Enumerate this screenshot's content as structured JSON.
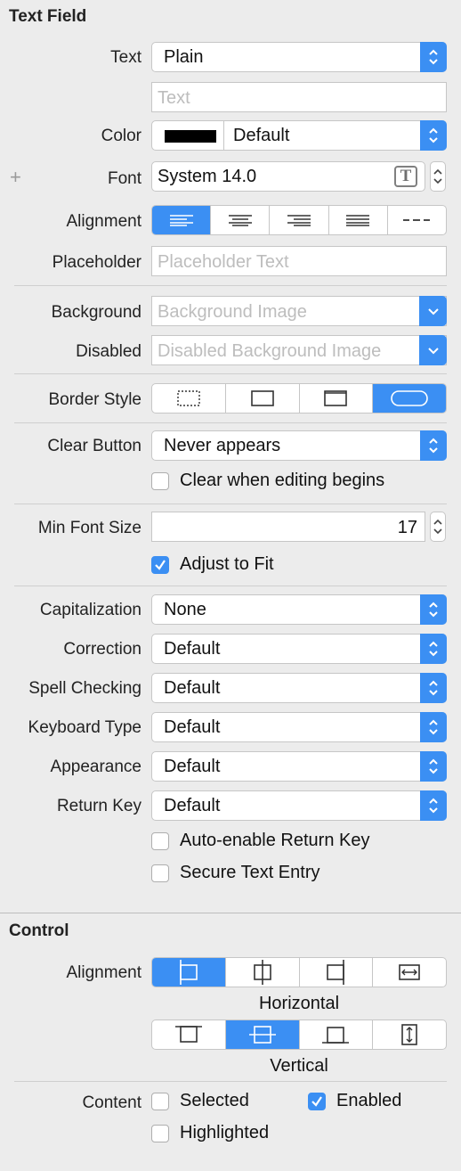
{
  "text_field": {
    "section_title": "Text Field",
    "text_label": "Text",
    "text_type_value": "Plain",
    "text_placeholder": "Text",
    "color_label": "Color",
    "color_value": "Default",
    "color_swatch": "#000000",
    "add_symbol": "+",
    "font_label": "Font",
    "font_value": "System 14.0",
    "font_icon_glyph": "T",
    "alignment_label": "Alignment",
    "placeholder_label": "Placeholder",
    "placeholder_placeholder": "Placeholder Text",
    "background_label": "Background",
    "background_placeholder": "Background Image",
    "disabled_label": "Disabled",
    "disabled_placeholder": "Disabled Background Image",
    "border_style_label": "Border Style",
    "clear_button_label": "Clear Button",
    "clear_button_value": "Never appears",
    "clear_when_editing_label": "Clear when editing begins",
    "clear_when_editing_checked": false,
    "min_font_size_label": "Min Font Size",
    "min_font_size_value": "17",
    "adjust_to_fit_label": "Adjust to Fit",
    "adjust_to_fit_checked": true,
    "capitalization_label": "Capitalization",
    "capitalization_value": "None",
    "correction_label": "Correction",
    "correction_value": "Default",
    "spell_checking_label": "Spell Checking",
    "spell_checking_value": "Default",
    "keyboard_type_label": "Keyboard Type",
    "keyboard_type_value": "Default",
    "appearance_label": "Appearance",
    "appearance_value": "Default",
    "return_key_label": "Return Key",
    "return_key_value": "Default",
    "auto_enable_return_key_label": "Auto-enable Return Key",
    "secure_text_entry_label": "Secure Text Entry"
  },
  "control": {
    "section_title": "Control",
    "alignment_label": "Alignment",
    "horizontal_label": "Horizontal",
    "vertical_label": "Vertical",
    "content_label": "Content",
    "selected_label": "Selected",
    "selected_checked": false,
    "enabled_label": "Enabled",
    "enabled_checked": true,
    "highlighted_label": "Highlighted",
    "highlighted_checked": false
  },
  "colors": {
    "accent": "#3b8ff3",
    "background": "#ececec"
  }
}
